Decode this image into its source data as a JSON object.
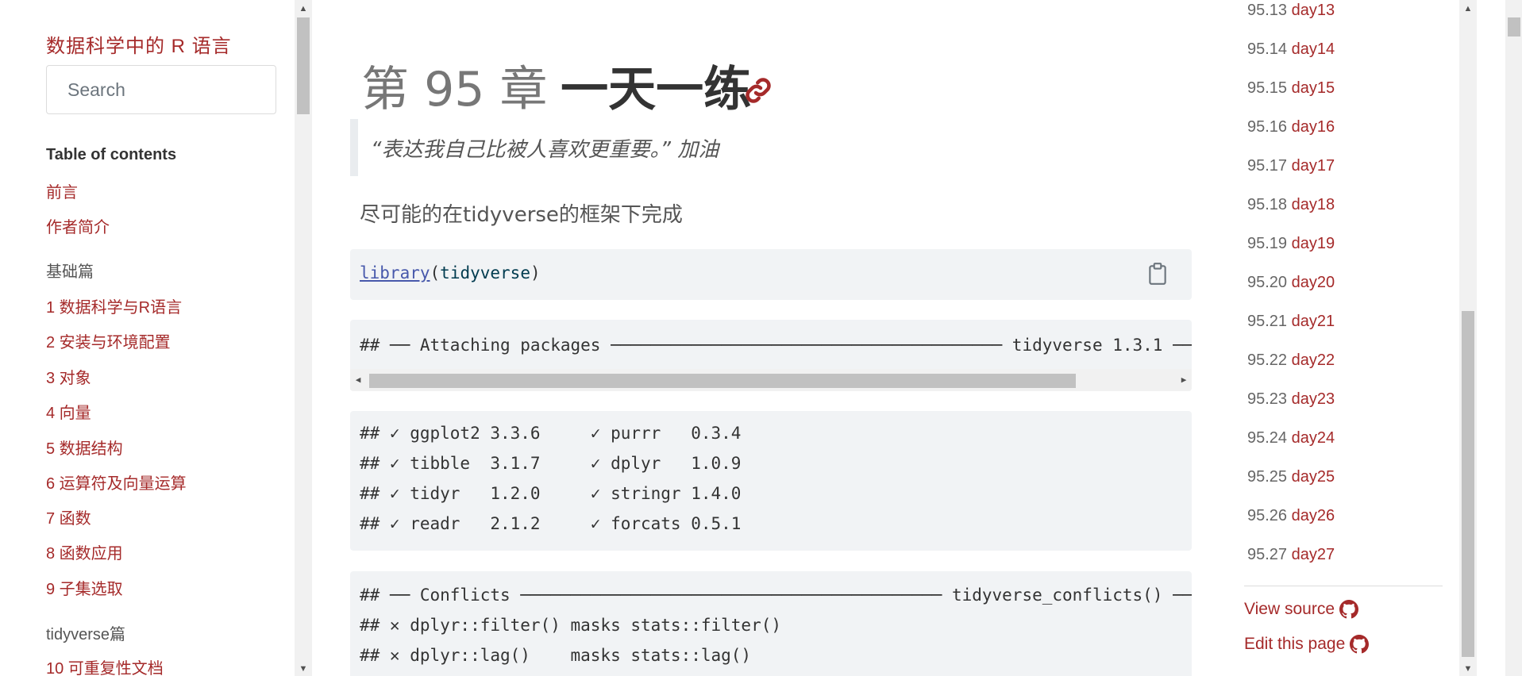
{
  "sidebar": {
    "book_title": "数据科学中的 R 语言",
    "search_placeholder": "Search",
    "toc_heading": "Table of contents",
    "items": [
      {
        "label": "前言"
      },
      {
        "label": "作者简介"
      },
      {
        "label": "基础篇"
      },
      {
        "label": "1 数据科学与R语言"
      },
      {
        "label": "2 安装与环境配置"
      },
      {
        "label": "3 对象"
      },
      {
        "label": "4 向量"
      },
      {
        "label": "5 数据结构"
      },
      {
        "label": "6 运算符及向量运算"
      },
      {
        "label": "7 函数"
      },
      {
        "label": "8 函数应用"
      },
      {
        "label": "9 子集选取"
      },
      {
        "label": "tidyverse篇"
      },
      {
        "label": "10 可重复性文档"
      }
    ]
  },
  "main": {
    "chapter_number": "第 95 章",
    "chapter_name": "一天一练",
    "quote": "“表达我自己比被人喜欢更重要。” 加油",
    "paragraph": "尽可能的在tidyverse的框架下完成",
    "code": {
      "fn": "library",
      "open": "(",
      "pkg": "tidyverse",
      "close": ")"
    },
    "output_attach": "## ── Attaching packages ─────────────────────────────────────── tidyverse 1.3.1 ──",
    "output_packages": [
      "## ✓ ggplot2 3.3.6     ✓ purrr   0.3.4",
      "## ✓ tibble  3.1.7     ✓ dplyr   1.0.9",
      "## ✓ tidyr   1.2.0     ✓ stringr 1.4.0",
      "## ✓ readr   2.1.2     ✓ forcats 0.5.1"
    ],
    "output_conflicts": [
      "## ── Conflicts ────────────────────────────────────────── tidyverse_conflicts() ──",
      "## ✕ dplyr::filter() masks stats::filter()",
      "## ✕ dplyr::lag()    masks stats::lag()"
    ]
  },
  "right_toc": {
    "items": [
      {
        "sec": "95.13",
        "label": "day13"
      },
      {
        "sec": "95.14",
        "label": "day14"
      },
      {
        "sec": "95.15",
        "label": "day15"
      },
      {
        "sec": "95.16",
        "label": "day16"
      },
      {
        "sec": "95.17",
        "label": "day17"
      },
      {
        "sec": "95.18",
        "label": "day18"
      },
      {
        "sec": "95.19",
        "label": "day19"
      },
      {
        "sec": "95.20",
        "label": "day20"
      },
      {
        "sec": "95.21",
        "label": "day21"
      },
      {
        "sec": "95.22",
        "label": "day22"
      },
      {
        "sec": "95.23",
        "label": "day23"
      },
      {
        "sec": "95.24",
        "label": "day24"
      },
      {
        "sec": "95.25",
        "label": "day25"
      },
      {
        "sec": "95.26",
        "label": "day26"
      },
      {
        "sec": "95.27",
        "label": "day27"
      }
    ],
    "view_source": "View source",
    "edit_page": "Edit this page"
  },
  "icons": {
    "anchor": "link-icon",
    "copy": "clipboard-icon",
    "github": "github-icon"
  },
  "colors": {
    "accent": "#a52a2a",
    "code_bg": "#f1f3f5",
    "text_muted": "#555555"
  }
}
